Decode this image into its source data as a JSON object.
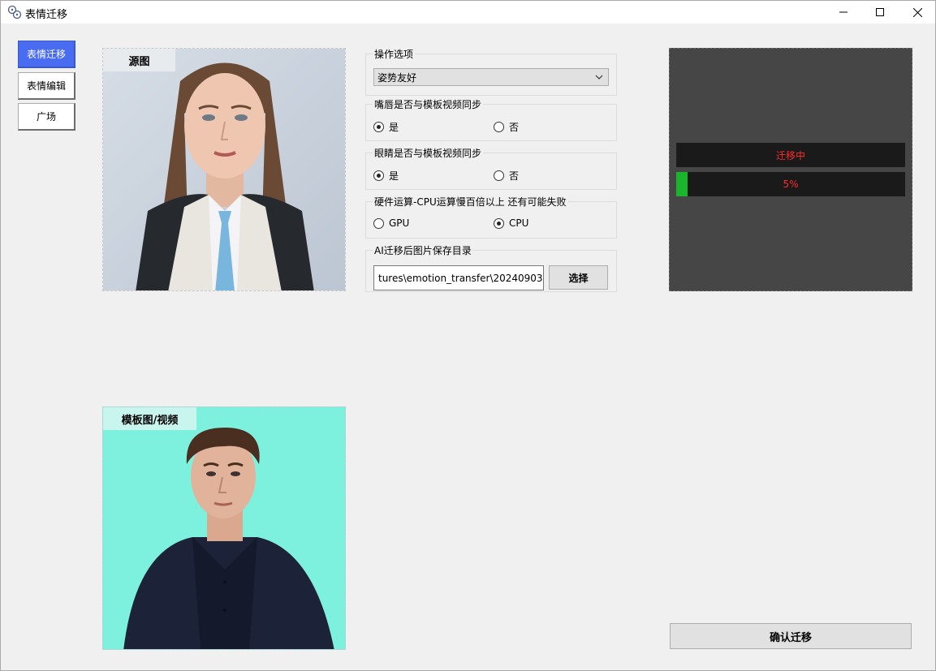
{
  "window": {
    "title": "表情迁移"
  },
  "nav": [
    {
      "label": "表情迁移",
      "active": true
    },
    {
      "label": "表情编辑",
      "active": false
    },
    {
      "label": "广场",
      "active": false
    }
  ],
  "source_panel": {
    "label": "源图"
  },
  "template_panel": {
    "label": "模板图/视频"
  },
  "options": {
    "title": "操作选项",
    "selected": "姿势友好"
  },
  "lip_sync": {
    "title": "嘴唇是否与模板视频同步",
    "yes": "是",
    "no": "否",
    "value": "yes"
  },
  "eye_sync": {
    "title": "眼睛是否与模板视频同步",
    "yes": "是",
    "no": "否",
    "value": "yes"
  },
  "hardware": {
    "title": "硬件运算-CPU运算慢百倍以上 还有可能失败",
    "gpu": "GPU",
    "cpu": "CPU",
    "value": "cpu"
  },
  "save_dir": {
    "title": "AI迁移后图片保存目录",
    "value": "tures\\emotion_transfer\\20240903",
    "button": "选择"
  },
  "progress": {
    "status": "迁移中",
    "percent_text": "5%",
    "percent": 5
  },
  "confirm_button": "确认迁移",
  "colors": {
    "accent": "#4a6cf0",
    "progress_fill": "#19b52a",
    "status_text": "#ff2a2a",
    "template_bg": "#7ef0de"
  }
}
